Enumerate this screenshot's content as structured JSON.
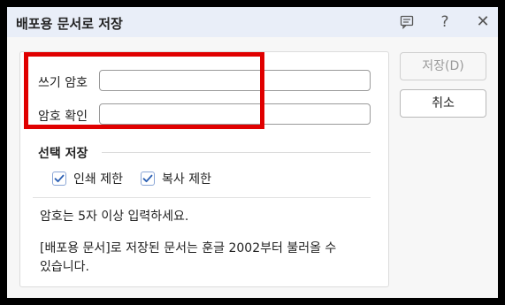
{
  "dialog": {
    "title": "배포용 문서로 저장",
    "comment_icon": "comment-icon",
    "help_label": "?",
    "close_label": "✕"
  },
  "form": {
    "password_label": "쓰기 암호",
    "password_value": "",
    "confirm_label": "암호 확인",
    "confirm_value": ""
  },
  "options": {
    "section_title": "선택 저장",
    "print_restrict": {
      "label": "인쇄 제한",
      "checked": true
    },
    "copy_restrict": {
      "label": "복사 제한",
      "checked": true
    }
  },
  "info": {
    "line1": "암호는 5자 이상 입력하세요.",
    "line2a": "[배포용 문서]로 저장된 문서는 훈글 2002부터 불러올 수",
    "line2b": "있습니다."
  },
  "buttons": {
    "save": "저장(D)",
    "cancel": "취소"
  },
  "colors": {
    "titlebar": "#e9eef8",
    "highlight": "#e00000",
    "checkbox_border": "#8aa6d6",
    "checkmark": "#2b5fb3"
  }
}
